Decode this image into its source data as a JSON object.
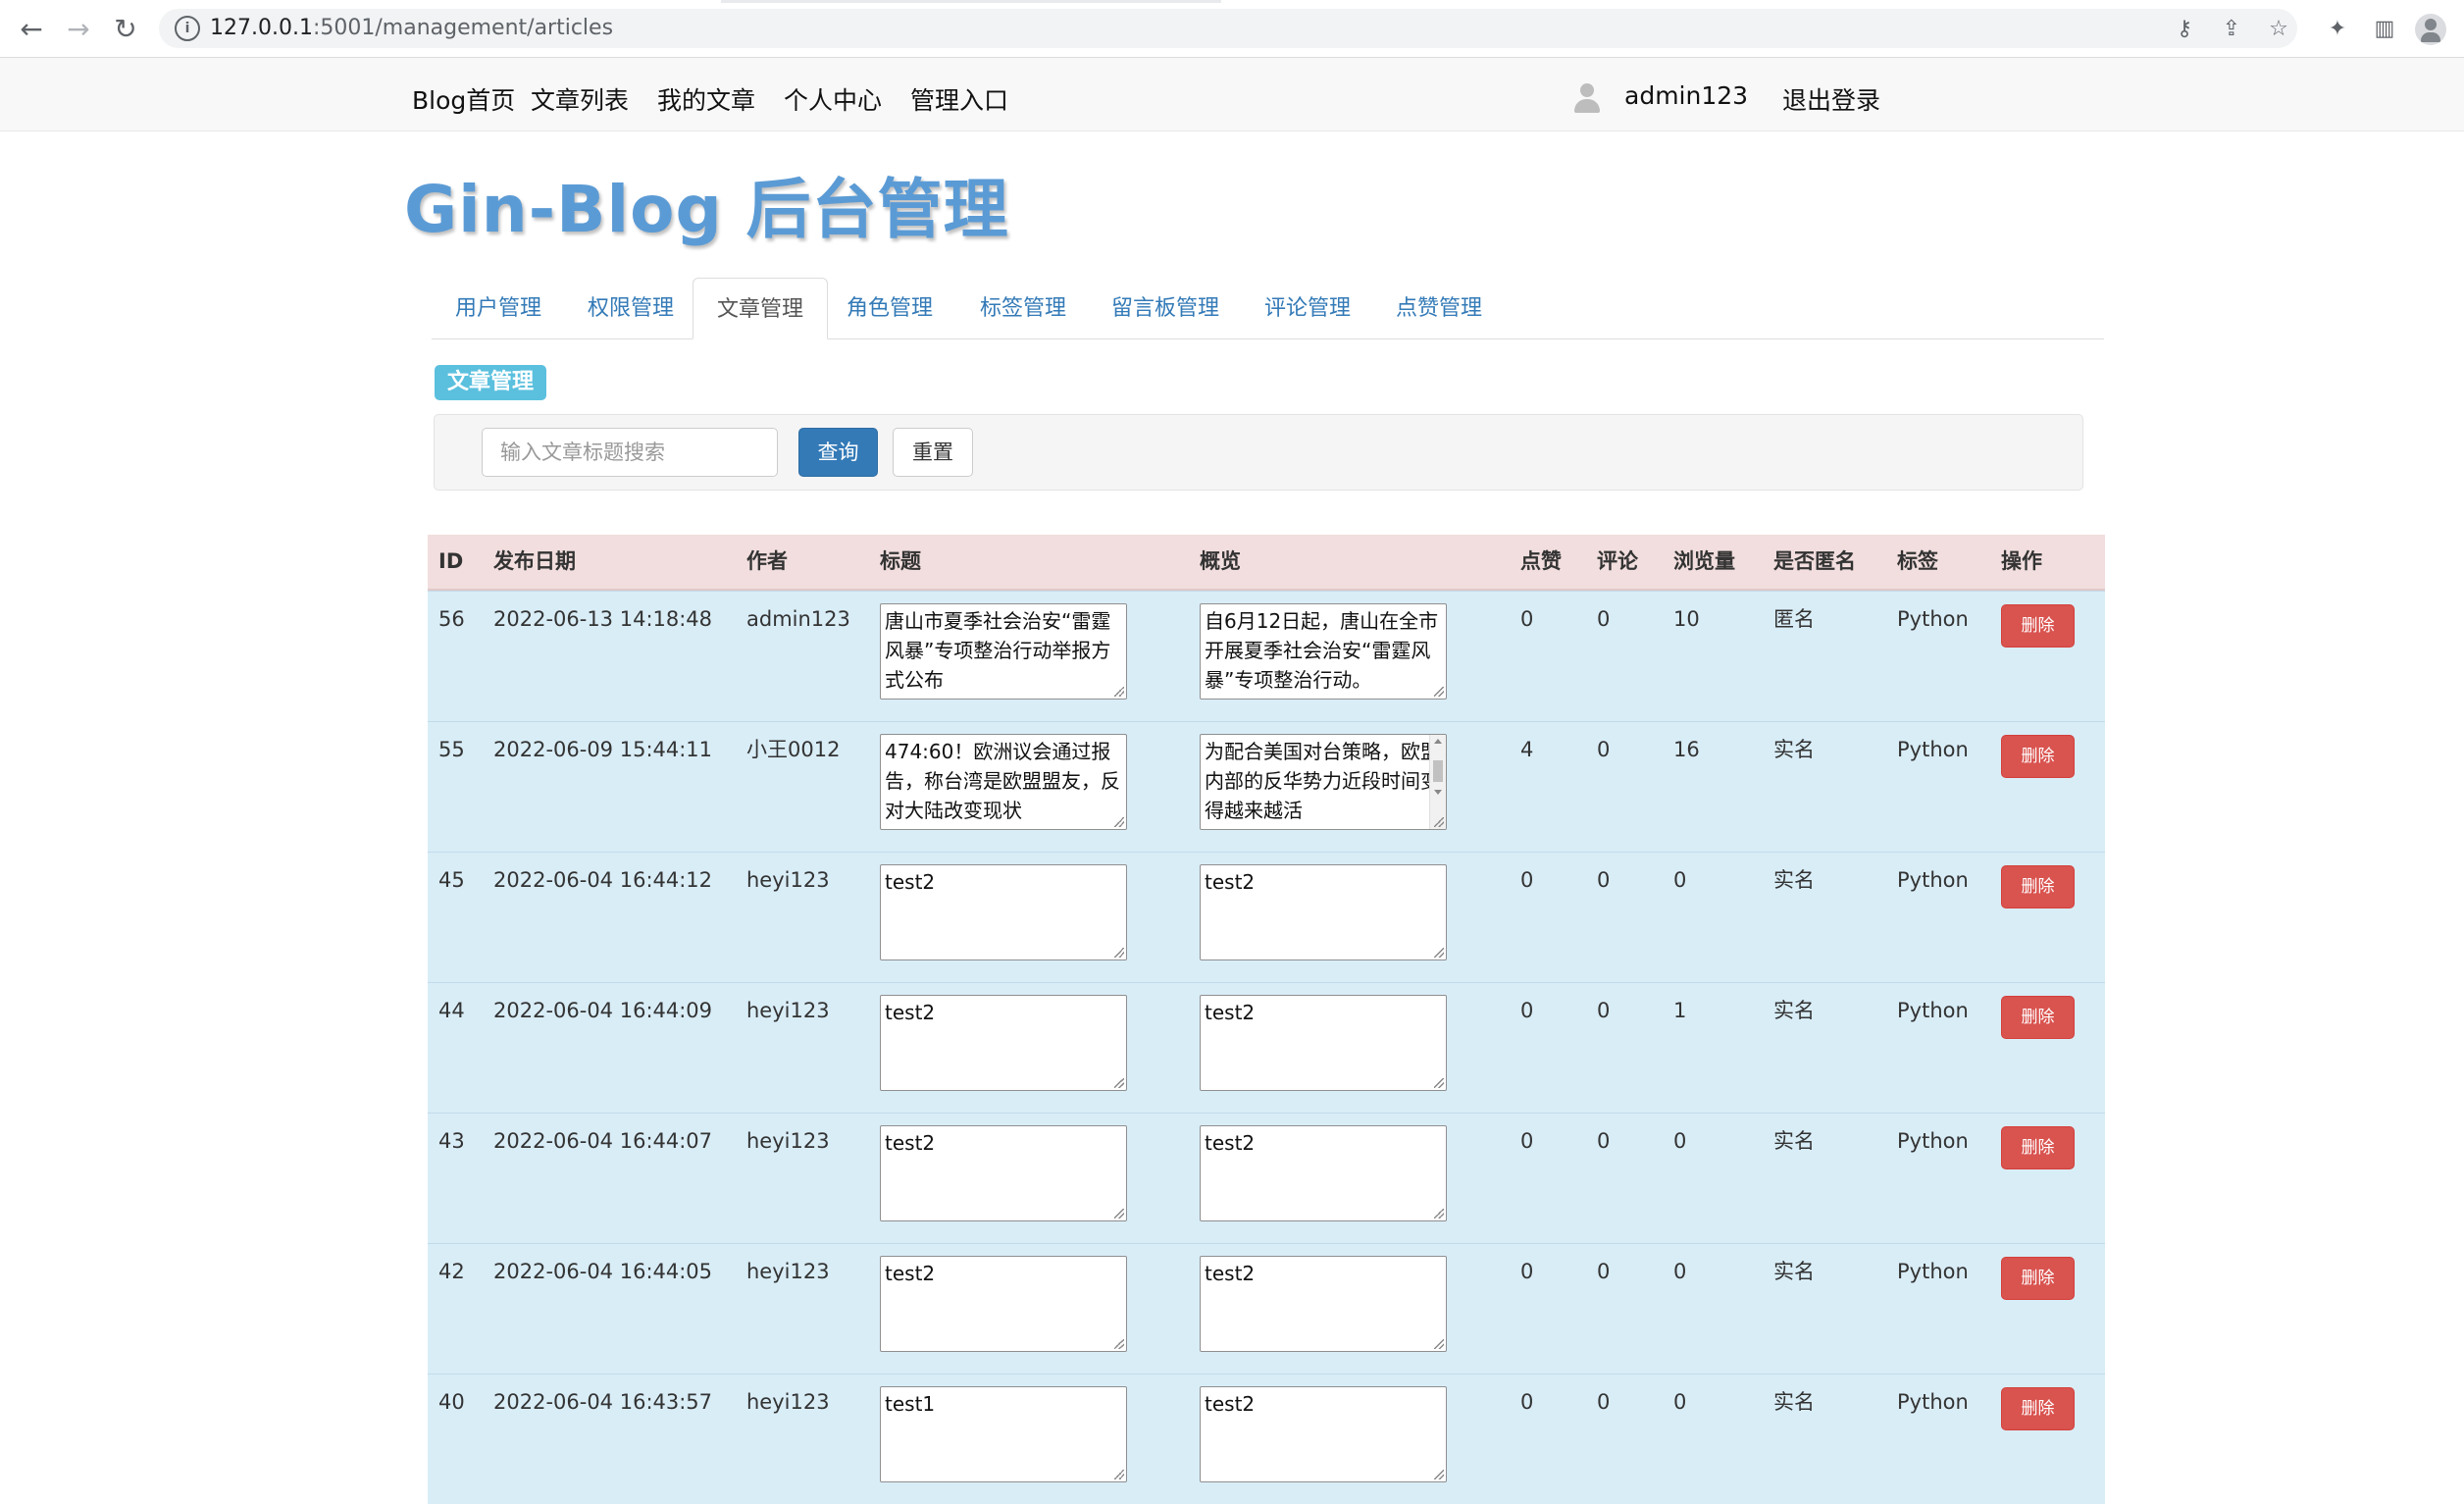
{
  "browser": {
    "url_host": "127.0.0.1",
    "url_path": ":5001/management/articles",
    "back_icon": "←",
    "forward_icon": "→",
    "reload_icon": "↻"
  },
  "navbar": {
    "links": [
      "Blog首页",
      "文章列表",
      "我的文章",
      "个人中心",
      "管理入口"
    ],
    "username": "admin123",
    "logout": "退出登录"
  },
  "brand": "Gin-Blog 后台管理",
  "tabs": [
    "用户管理",
    "权限管理",
    "文章管理",
    "角色管理",
    "标签管理",
    "留言板管理",
    "评论管理",
    "点赞管理"
  ],
  "active_tab": "文章管理",
  "section_label": "文章管理",
  "search": {
    "placeholder": "输入文章标题搜索",
    "value": "",
    "query_button": "查询",
    "reset_button": "重置"
  },
  "table": {
    "headers": [
      "ID",
      "发布日期",
      "作者",
      "标题",
      "概览",
      "点赞",
      "评论",
      "浏览量",
      "是否匿名",
      "标签",
      "操作"
    ],
    "delete_label": "删除",
    "rows": [
      {
        "id": "56",
        "date": "2022-06-13 14:18:48",
        "author": "admin123",
        "title": "唐山市夏季社会治安“雷霆风暴”专项整治行动举报方式公布",
        "summary": "自6月12日起，唐山在全市开展夏季社会治安“雷霆风暴”专项整治行动。",
        "likes": "0",
        "comments": "0",
        "views": "10",
        "anon": "匿名",
        "tag": "Python"
      },
      {
        "id": "55",
        "date": "2022-06-09 15:44:11",
        "author": "小王0012",
        "title": "474:60！欧洲议会通过报告，称台湾是欧盟盟友，反对大陆改变现状",
        "summary": "为配合美国对台策略，欧盟内部的反华势力近段时间变得越来越活",
        "likes": "4",
        "comments": "0",
        "views": "16",
        "anon": "实名",
        "tag": "Python"
      },
      {
        "id": "45",
        "date": "2022-06-04 16:44:12",
        "author": "heyi123",
        "title": "test2",
        "summary": "test2",
        "likes": "0",
        "comments": "0",
        "views": "0",
        "anon": "实名",
        "tag": "Python"
      },
      {
        "id": "44",
        "date": "2022-06-04 16:44:09",
        "author": "heyi123",
        "title": "test2",
        "summary": "test2",
        "likes": "0",
        "comments": "0",
        "views": "1",
        "anon": "实名",
        "tag": "Python"
      },
      {
        "id": "43",
        "date": "2022-06-04 16:44:07",
        "author": "heyi123",
        "title": "test2",
        "summary": "test2",
        "likes": "0",
        "comments": "0",
        "views": "0",
        "anon": "实名",
        "tag": "Python"
      },
      {
        "id": "42",
        "date": "2022-06-04 16:44:05",
        "author": "heyi123",
        "title": "test2",
        "summary": "test2",
        "likes": "0",
        "comments": "0",
        "views": "0",
        "anon": "实名",
        "tag": "Python"
      },
      {
        "id": "40",
        "date": "2022-06-04 16:43:57",
        "author": "heyi123",
        "title": "test1",
        "summary": "test2",
        "likes": "0",
        "comments": "0",
        "views": "0",
        "anon": "实名",
        "tag": "Python"
      }
    ]
  }
}
